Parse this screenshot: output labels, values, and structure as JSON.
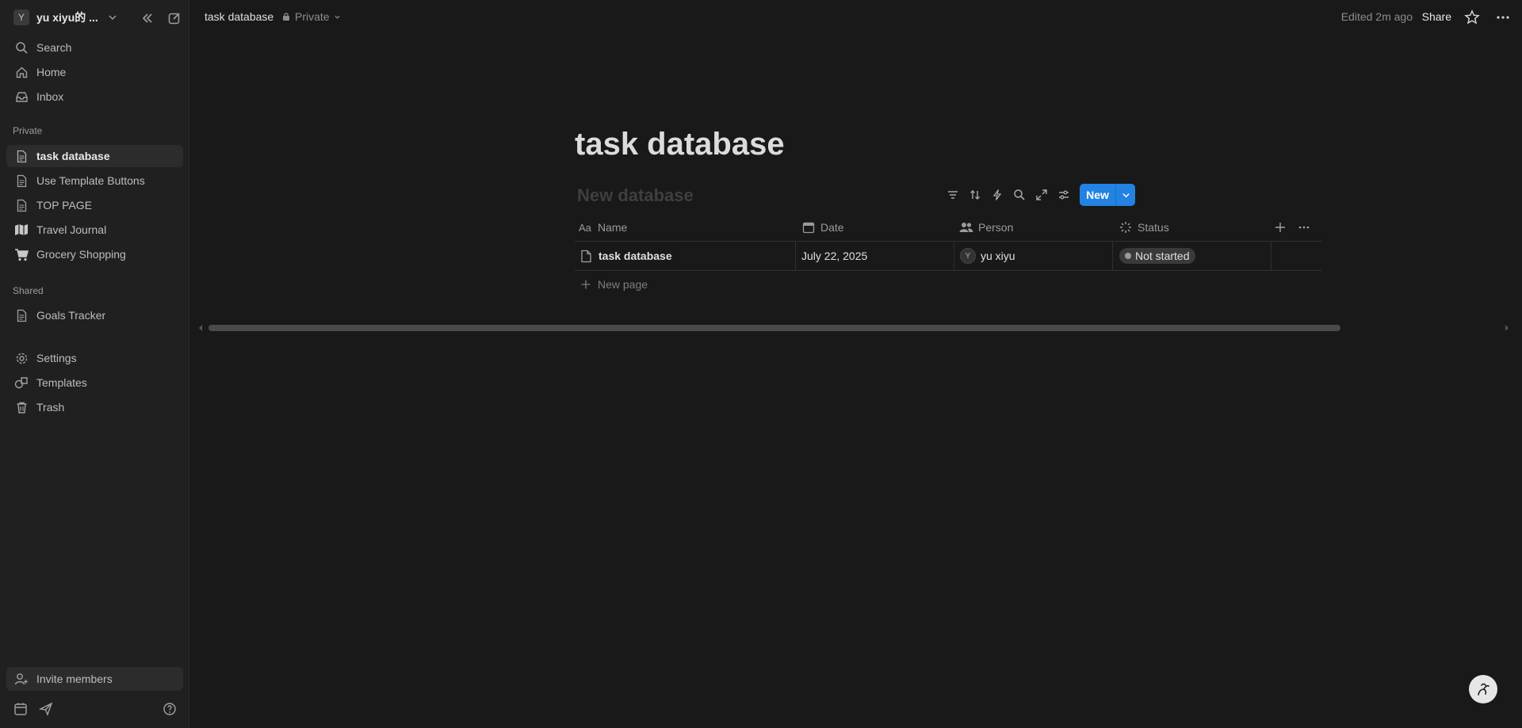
{
  "workspace": {
    "avatar_letter": "Y",
    "name": "yu xiyu的 ..."
  },
  "sidebar": {
    "top_items": [
      {
        "label": "Search",
        "icon": "search-icon"
      },
      {
        "label": "Home",
        "icon": "home-icon"
      },
      {
        "label": "Inbox",
        "icon": "inbox-icon"
      }
    ],
    "private_label": "Private",
    "private_items": [
      {
        "label": "task database",
        "icon": "page-icon",
        "active": true
      },
      {
        "label": "Use Template Buttons",
        "icon": "page-icon"
      },
      {
        "label": "TOP PAGE",
        "icon": "page-icon"
      },
      {
        "label": "Travel Journal",
        "icon": "map-icon"
      },
      {
        "label": "Grocery Shopping",
        "icon": "cart-icon"
      }
    ],
    "shared_label": "Shared",
    "shared_items": [
      {
        "label": "Goals Tracker",
        "icon": "page-icon"
      }
    ],
    "bottom_items": [
      {
        "label": "Settings",
        "icon": "gear-icon"
      },
      {
        "label": "Templates",
        "icon": "shapes-icon"
      },
      {
        "label": "Trash",
        "icon": "trash-icon"
      }
    ],
    "invite_label": "Invite members"
  },
  "topbar": {
    "breadcrumb": "task database",
    "privacy": "Private",
    "edited": "Edited 2m ago",
    "share": "Share"
  },
  "page": {
    "title": "task database",
    "database_title": "New database",
    "new_button": "New",
    "columns": [
      "Name",
      "Date",
      "Person",
      "Status"
    ],
    "rows": [
      {
        "name": "task database",
        "date": "July 22, 2025",
        "person_initial": "Y",
        "person": "yu xiyu",
        "status": "Not started"
      }
    ],
    "new_page_label": "New page"
  },
  "colors": {
    "accent": "#2383e2",
    "background": "#191919",
    "sidebar": "#202020"
  }
}
